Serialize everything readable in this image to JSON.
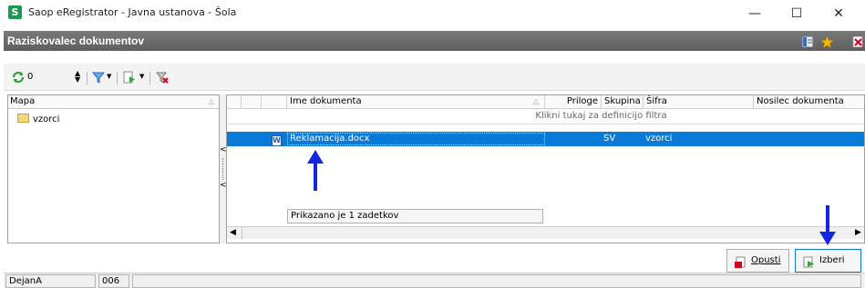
{
  "window": {
    "title": "Saop eRegistrator - Javna ustanova - Šola",
    "app_icon_letter": "S"
  },
  "window_controls": {
    "minimize": "—",
    "maximize": "☐",
    "close": "✕"
  },
  "header": {
    "title": "Raziskovalec dokumentov"
  },
  "toolbar": {
    "counter_value": "0"
  },
  "left_pane": {
    "column_header": "Mapa",
    "tree_items": [
      {
        "label": "vzorci"
      }
    ]
  },
  "grid": {
    "columns": [
      "Ime dokumenta",
      "Priloge",
      "Skupina",
      "Šifra",
      "Nosilec dokumenta"
    ],
    "filter_hint": "Klikni tukaj za definicijo filtra",
    "rows": [
      {
        "name": "Reklamacija.docx",
        "skupina": "SV",
        "sifra": "vzorci"
      }
    ],
    "footer": "Prikazano je 1 zadetkov"
  },
  "buttons": {
    "cancel_label": "Opusti",
    "select_label": "Izberi"
  },
  "status_bar": {
    "user": "DejanA",
    "code": "006"
  },
  "colors": {
    "selection": "#0a7ad9",
    "header_band": "#6b6b6b",
    "annotation_arrow": "#1526e0"
  }
}
